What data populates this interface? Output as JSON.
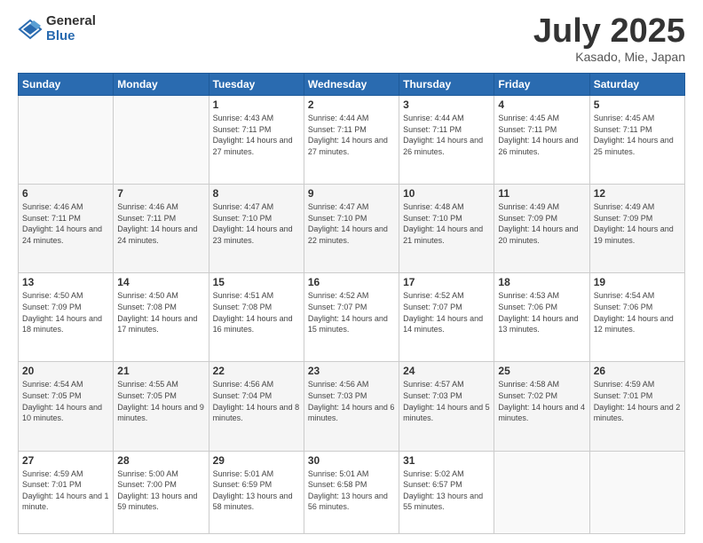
{
  "logo": {
    "general": "General",
    "blue": "Blue"
  },
  "title": "July 2025",
  "location": "Kasado, Mie, Japan",
  "weekdays": [
    "Sunday",
    "Monday",
    "Tuesday",
    "Wednesday",
    "Thursday",
    "Friday",
    "Saturday"
  ],
  "weeks": [
    [
      {
        "day": "",
        "sunrise": "",
        "sunset": "",
        "daylight": ""
      },
      {
        "day": "",
        "sunrise": "",
        "sunset": "",
        "daylight": ""
      },
      {
        "day": "1",
        "sunrise": "Sunrise: 4:43 AM",
        "sunset": "Sunset: 7:11 PM",
        "daylight": "Daylight: 14 hours and 27 minutes."
      },
      {
        "day": "2",
        "sunrise": "Sunrise: 4:44 AM",
        "sunset": "Sunset: 7:11 PM",
        "daylight": "Daylight: 14 hours and 27 minutes."
      },
      {
        "day": "3",
        "sunrise": "Sunrise: 4:44 AM",
        "sunset": "Sunset: 7:11 PM",
        "daylight": "Daylight: 14 hours and 26 minutes."
      },
      {
        "day": "4",
        "sunrise": "Sunrise: 4:45 AM",
        "sunset": "Sunset: 7:11 PM",
        "daylight": "Daylight: 14 hours and 26 minutes."
      },
      {
        "day": "5",
        "sunrise": "Sunrise: 4:45 AM",
        "sunset": "Sunset: 7:11 PM",
        "daylight": "Daylight: 14 hours and 25 minutes."
      }
    ],
    [
      {
        "day": "6",
        "sunrise": "Sunrise: 4:46 AM",
        "sunset": "Sunset: 7:11 PM",
        "daylight": "Daylight: 14 hours and 24 minutes."
      },
      {
        "day": "7",
        "sunrise": "Sunrise: 4:46 AM",
        "sunset": "Sunset: 7:11 PM",
        "daylight": "Daylight: 14 hours and 24 minutes."
      },
      {
        "day": "8",
        "sunrise": "Sunrise: 4:47 AM",
        "sunset": "Sunset: 7:10 PM",
        "daylight": "Daylight: 14 hours and 23 minutes."
      },
      {
        "day": "9",
        "sunrise": "Sunrise: 4:47 AM",
        "sunset": "Sunset: 7:10 PM",
        "daylight": "Daylight: 14 hours and 22 minutes."
      },
      {
        "day": "10",
        "sunrise": "Sunrise: 4:48 AM",
        "sunset": "Sunset: 7:10 PM",
        "daylight": "Daylight: 14 hours and 21 minutes."
      },
      {
        "day": "11",
        "sunrise": "Sunrise: 4:49 AM",
        "sunset": "Sunset: 7:09 PM",
        "daylight": "Daylight: 14 hours and 20 minutes."
      },
      {
        "day": "12",
        "sunrise": "Sunrise: 4:49 AM",
        "sunset": "Sunset: 7:09 PM",
        "daylight": "Daylight: 14 hours and 19 minutes."
      }
    ],
    [
      {
        "day": "13",
        "sunrise": "Sunrise: 4:50 AM",
        "sunset": "Sunset: 7:09 PM",
        "daylight": "Daylight: 14 hours and 18 minutes."
      },
      {
        "day": "14",
        "sunrise": "Sunrise: 4:50 AM",
        "sunset": "Sunset: 7:08 PM",
        "daylight": "Daylight: 14 hours and 17 minutes."
      },
      {
        "day": "15",
        "sunrise": "Sunrise: 4:51 AM",
        "sunset": "Sunset: 7:08 PM",
        "daylight": "Daylight: 14 hours and 16 minutes."
      },
      {
        "day": "16",
        "sunrise": "Sunrise: 4:52 AM",
        "sunset": "Sunset: 7:07 PM",
        "daylight": "Daylight: 14 hours and 15 minutes."
      },
      {
        "day": "17",
        "sunrise": "Sunrise: 4:52 AM",
        "sunset": "Sunset: 7:07 PM",
        "daylight": "Daylight: 14 hours and 14 minutes."
      },
      {
        "day": "18",
        "sunrise": "Sunrise: 4:53 AM",
        "sunset": "Sunset: 7:06 PM",
        "daylight": "Daylight: 14 hours and 13 minutes."
      },
      {
        "day": "19",
        "sunrise": "Sunrise: 4:54 AM",
        "sunset": "Sunset: 7:06 PM",
        "daylight": "Daylight: 14 hours and 12 minutes."
      }
    ],
    [
      {
        "day": "20",
        "sunrise": "Sunrise: 4:54 AM",
        "sunset": "Sunset: 7:05 PM",
        "daylight": "Daylight: 14 hours and 10 minutes."
      },
      {
        "day": "21",
        "sunrise": "Sunrise: 4:55 AM",
        "sunset": "Sunset: 7:05 PM",
        "daylight": "Daylight: 14 hours and 9 minutes."
      },
      {
        "day": "22",
        "sunrise": "Sunrise: 4:56 AM",
        "sunset": "Sunset: 7:04 PM",
        "daylight": "Daylight: 14 hours and 8 minutes."
      },
      {
        "day": "23",
        "sunrise": "Sunrise: 4:56 AM",
        "sunset": "Sunset: 7:03 PM",
        "daylight": "Daylight: 14 hours and 6 minutes."
      },
      {
        "day": "24",
        "sunrise": "Sunrise: 4:57 AM",
        "sunset": "Sunset: 7:03 PM",
        "daylight": "Daylight: 14 hours and 5 minutes."
      },
      {
        "day": "25",
        "sunrise": "Sunrise: 4:58 AM",
        "sunset": "Sunset: 7:02 PM",
        "daylight": "Daylight: 14 hours and 4 minutes."
      },
      {
        "day": "26",
        "sunrise": "Sunrise: 4:59 AM",
        "sunset": "Sunset: 7:01 PM",
        "daylight": "Daylight: 14 hours and 2 minutes."
      }
    ],
    [
      {
        "day": "27",
        "sunrise": "Sunrise: 4:59 AM",
        "sunset": "Sunset: 7:01 PM",
        "daylight": "Daylight: 14 hours and 1 minute."
      },
      {
        "day": "28",
        "sunrise": "Sunrise: 5:00 AM",
        "sunset": "Sunset: 7:00 PM",
        "daylight": "Daylight: 13 hours and 59 minutes."
      },
      {
        "day": "29",
        "sunrise": "Sunrise: 5:01 AM",
        "sunset": "Sunset: 6:59 PM",
        "daylight": "Daylight: 13 hours and 58 minutes."
      },
      {
        "day": "30",
        "sunrise": "Sunrise: 5:01 AM",
        "sunset": "Sunset: 6:58 PM",
        "daylight": "Daylight: 13 hours and 56 minutes."
      },
      {
        "day": "31",
        "sunrise": "Sunrise: 5:02 AM",
        "sunset": "Sunset: 6:57 PM",
        "daylight": "Daylight: 13 hours and 55 minutes."
      },
      {
        "day": "",
        "sunrise": "",
        "sunset": "",
        "daylight": ""
      },
      {
        "day": "",
        "sunrise": "",
        "sunset": "",
        "daylight": ""
      }
    ]
  ]
}
